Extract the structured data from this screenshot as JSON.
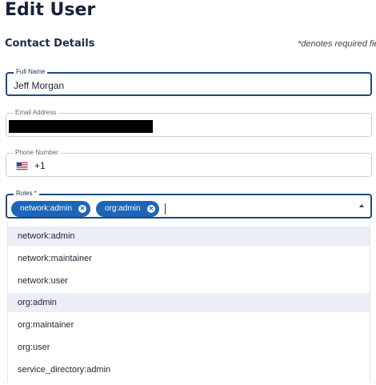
{
  "header": {
    "title": "Edit User"
  },
  "section": {
    "title": "Contact Details",
    "required_note": "*denotes required fie"
  },
  "fields": {
    "full_name": {
      "label": "Full Name",
      "value": "Jeff Morgan"
    },
    "email": {
      "label": "Email Address",
      "value": ""
    },
    "phone": {
      "label": "Phone Number",
      "country_code": "+1",
      "flag_icon": "us-flag-icon"
    },
    "roles": {
      "label": "Roles *",
      "selected": [
        {
          "label": "network:admin"
        },
        {
          "label": "org:admin"
        }
      ]
    }
  },
  "dropdown": {
    "options": [
      {
        "label": "network:admin",
        "selected": true
      },
      {
        "label": "network:maintainer",
        "selected": false
      },
      {
        "label": "network:user",
        "selected": false
      },
      {
        "label": "org:admin",
        "selected": true
      },
      {
        "label": "org:maintainer",
        "selected": false
      },
      {
        "label": "org:user",
        "selected": false
      },
      {
        "label": "service_directory:admin",
        "selected": false
      }
    ]
  },
  "colors": {
    "chip_background": "#1d65b8",
    "active_border": "#1f4a7d",
    "selected_option_background": "#ebedf7",
    "title_text": "#15233d"
  }
}
